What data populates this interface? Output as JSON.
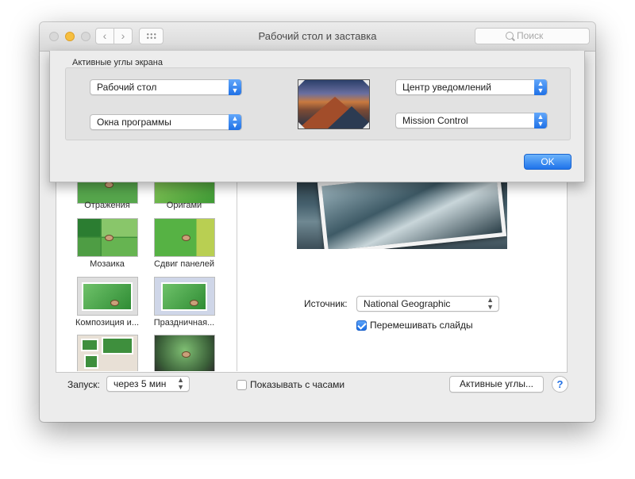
{
  "window": {
    "title": "Рабочий стол и заставка",
    "search_placeholder": "Поиск"
  },
  "screensavers": [
    {
      "label": "Отражения"
    },
    {
      "label": "Оригами"
    },
    {
      "label": "Мозаика"
    },
    {
      "label": "Сдвиг панелей"
    },
    {
      "label": "Композиция и..."
    },
    {
      "label": "Праздничная..."
    }
  ],
  "source": {
    "label": "Источник:",
    "value": "National Geographic",
    "shuffle_label": "Перемешивать слайды",
    "shuffle_checked": true
  },
  "bottom": {
    "start_label": "Запуск:",
    "start_value": "через 5 мин",
    "show_clock_label": "Показывать с часами",
    "show_clock_checked": false,
    "hot_corners_button": "Активные углы...",
    "help": "?"
  },
  "sheet": {
    "group_title": "Активные углы экрана",
    "top_left": "Рабочий стол",
    "bottom_left": "Окна программы",
    "top_right": "Центр уведомлений",
    "bottom_right": "Mission Control",
    "ok_label": "OK"
  },
  "colors": {
    "accent": "#1f73ea",
    "window_bg": "#ececec",
    "minimize_light": "#f6bf40"
  },
  "icons": [
    "chevron-left-icon",
    "chevron-right-icon",
    "grid-icon",
    "search-icon",
    "stepper-icon",
    "checkmark-icon",
    "help-icon"
  ]
}
